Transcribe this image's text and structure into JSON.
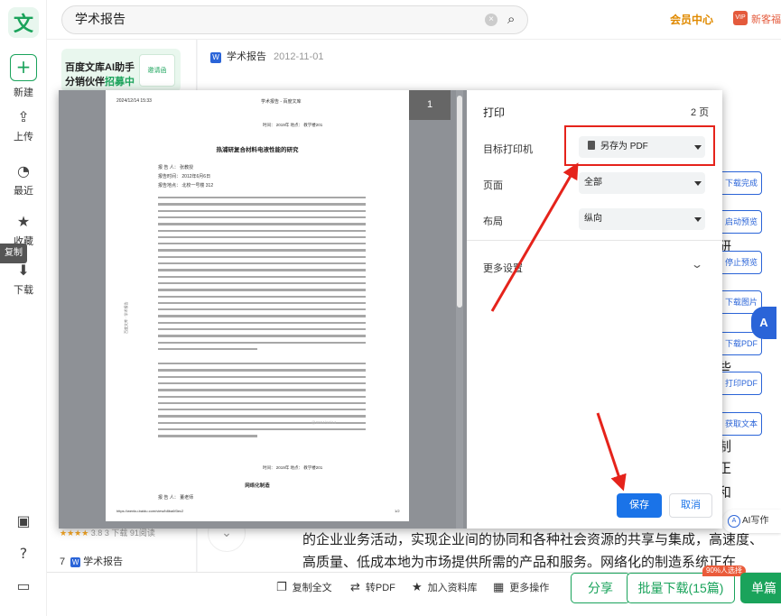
{
  "rail": {
    "logo": "文",
    "new_label": "新建",
    "upload_label": "上传",
    "recent_label": "最近",
    "fav_label": "收藏",
    "download_label": "下载",
    "copy_tag": "复制"
  },
  "topbar": {
    "search_value": "学术报告",
    "member_center": "会员中心",
    "vip_badge": "VIP",
    "newbie_gift": "新客福利"
  },
  "sidebar": {
    "promo_line1": "百度文库AI助手",
    "promo_line2_prefix": "分销伙伴",
    "promo_line2_highlight": "招募中",
    "promo_img_text": "邀请函",
    "item_rating": "3.8",
    "item_pages": "3 下载",
    "item_reads": "91阅读",
    "item7_index": "7",
    "item7_title": "学术报告",
    "char_partial": "存"
  },
  "document": {
    "title": "学术报告",
    "date": "2012-11-01",
    "line1": "的企业业务活动，实现企业间的协同和各种社会资源的共享与集成，高速度、",
    "line2": "高质量、低成本地为市场提供所需的产品和服务。网络化的制造系统正在我们这",
    "edge_chars": [
      "研",
      "些",
      "悲",
      "制",
      "正",
      "和"
    ]
  },
  "tools": [
    "下载完成",
    "启动预览",
    "停止预览",
    "下载图片",
    "下载PDF",
    "打印PDF",
    "获取文本"
  ],
  "ai": {
    "badge": "A",
    "write": "AI写作"
  },
  "bottombar": {
    "copy_all": "复制全文",
    "to_pdf": "转PDF",
    "add_library": "加入资料库",
    "more_ops": "更多操作",
    "share": "分享",
    "batch_download": "批量下载(15篇)",
    "batch_badge": "90%人选择",
    "single": "单篇"
  },
  "print": {
    "page_badge": "1",
    "title": "打印",
    "pages": "2 页",
    "printer_label": "目标打印机",
    "printer_value": "另存为 PDF",
    "pages_label": "页面",
    "pages_value": "全部",
    "layout_label": "布局",
    "layout_value": "纵向",
    "more_settings": "更多设置",
    "save": "保存",
    "cancel": "取消"
  },
  "paper": {
    "timestamp": "2024/12/14 15:33",
    "site_title": "学术报告 - 百度文库",
    "meta_top": "时间： 2019年    地点： 教学楼201",
    "title": "热浦研复合材料电液性能的研究",
    "info_lines": [
      "报 告 人： 张教授",
      "报告时间： 2012年6月6日",
      "报告地点： 北校一号楼 312"
    ],
    "side_mark": "百度文库 · 学术报告",
    "watermark": "@2024/12/14",
    "sub_title": "网络化制造",
    "reporter2": "报 告 人： 董老师",
    "footer_url": "https://wenku.baidu.com/view/b8ba6f3ec2",
    "footer_page": "1/2"
  }
}
